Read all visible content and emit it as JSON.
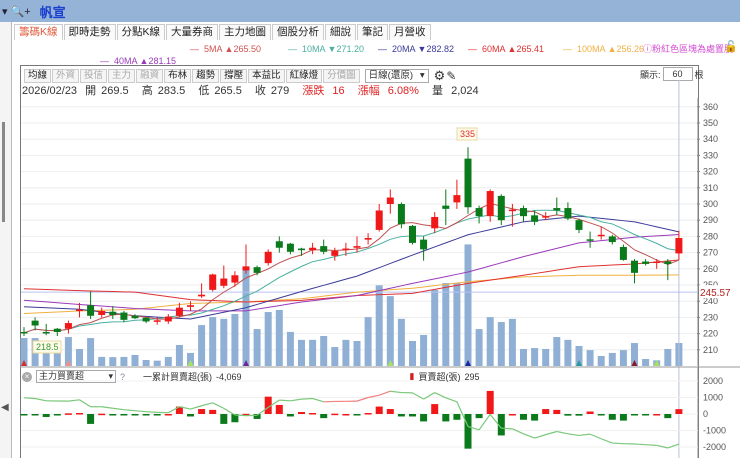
{
  "window": {
    "title": "帆宣",
    "dropdown_icon": "▾",
    "zoom_icon": "🔍+"
  },
  "tabs": [
    {
      "label": "籌碼K線",
      "active": true
    },
    {
      "label": "即時走勢"
    },
    {
      "label": "分點K線"
    },
    {
      "label": "大量券商"
    },
    {
      "label": "主力地圖"
    },
    {
      "label": "個股分析"
    },
    {
      "label": "細說"
    },
    {
      "label": "筆記"
    },
    {
      "label": "月營收"
    }
  ],
  "ma_legend": [
    {
      "name": "5MA",
      "dir": "▲",
      "value": "265.50",
      "color": "#d05050"
    },
    {
      "name": "10MA",
      "dir": "▼",
      "value": "271.20",
      "color": "#48b0a0"
    },
    {
      "name": "20MA",
      "dir": "▼",
      "value": "282.82",
      "color": "#3a3a9a"
    },
    {
      "name": "60MA",
      "dir": "▲",
      "value": "265.41",
      "color": "#e03030"
    },
    {
      "name": "100MA",
      "dir": "▲",
      "value": "256.26",
      "color": "#f0b040"
    },
    {
      "name": "40MA",
      "dir": "▲",
      "value": "281.15",
      "color": "#9a3aba"
    }
  ],
  "note": "ⓘ粉紅色區塊為處置股",
  "toolbar": {
    "buttons": [
      {
        "label": "均線"
      },
      {
        "label": "外資",
        "disabled": true
      },
      {
        "label": "投信",
        "disabled": true
      },
      {
        "label": "主力",
        "disabled": true
      },
      {
        "label": "融資",
        "disabled": true
      },
      {
        "label": "布林"
      },
      {
        "label": "趨勢"
      },
      {
        "label": "撐壓"
      },
      {
        "label": "本益比"
      },
      {
        "label": "紅綠燈"
      },
      {
        "label": "分價圖",
        "disabled": true
      }
    ],
    "period": "日線(還原)",
    "show_label": "顯示:",
    "show_count": "60",
    "show_unit": "根"
  },
  "info": {
    "date": "2026/02/23",
    "open_label": "開",
    "open": "269.5",
    "high_label": "高",
    "high": "283.5",
    "low_label": "低",
    "low": "265.5",
    "close_label": "收",
    "close": "279",
    "change_label": "漲跌",
    "change": "16",
    "pct_label": "漲幅",
    "pct": "6.08%",
    "vol_label": "量",
    "vol": "2,024"
  },
  "chart_data": {
    "type": "candlestick",
    "y_ticks": [
      360,
      350,
      340,
      330,
      320,
      310,
      300,
      290,
      280,
      270,
      260,
      250,
      240,
      230,
      220,
      210
    ],
    "ylim": [
      203,
      362
    ],
    "ref_line": {
      "value": 245.57,
      "label": "245.57"
    },
    "high_label": "335",
    "low_label": "218.5",
    "ohlc": [
      [
        221,
        224,
        218.5,
        220.5
      ],
      [
        228,
        230,
        222,
        225
      ],
      [
        221,
        226,
        219,
        220.5
      ],
      [
        223,
        223.5,
        218.5,
        221
      ],
      [
        223,
        228,
        220,
        226.5
      ],
      [
        234.5,
        239,
        230,
        234.8
      ],
      [
        237.5,
        246,
        229,
        231
      ],
      [
        231.5,
        236,
        230,
        234
      ],
      [
        233.5,
        237,
        229,
        231.5
      ],
      [
        233,
        234,
        227,
        228.5
      ],
      [
        231,
        232,
        229,
        229.5
      ],
      [
        229.8,
        230,
        226.5,
        227.5
      ],
      [
        228,
        230,
        225.5,
        228.2
      ],
      [
        227.5,
        232,
        226,
        230.5
      ],
      [
        231,
        239,
        230,
        236
      ],
      [
        236.5,
        240,
        234,
        237.5
      ],
      [
        243,
        251,
        242,
        244
      ],
      [
        247,
        257,
        246,
        256.5
      ],
      [
        249.5,
        262,
        248,
        254
      ],
      [
        251.5,
        258.5,
        249,
        256
      ],
      [
        259,
        275,
        257,
        261.5
      ],
      [
        261,
        262,
        256,
        257.5
      ],
      [
        263.5,
        272,
        262,
        270.5
      ],
      [
        277,
        280,
        270,
        273
      ],
      [
        275.5,
        276,
        269,
        270.5
      ],
      [
        272.5,
        273,
        268,
        271.5
      ],
      [
        271.5,
        276,
        269,
        273
      ],
      [
        274,
        278,
        269,
        270.5
      ],
      [
        268,
        273,
        265,
        271
      ],
      [
        272,
        276,
        268,
        272.5
      ],
      [
        273,
        280,
        270,
        274
      ],
      [
        278,
        282,
        275,
        279
      ],
      [
        284,
        300,
        283,
        296
      ],
      [
        300,
        309,
        294,
        304
      ],
      [
        300,
        301,
        285,
        287.5
      ],
      [
        286.5,
        287,
        275,
        276
      ],
      [
        278,
        280,
        265,
        272
      ],
      [
        285,
        295,
        282,
        292
      ],
      [
        299,
        309,
        287,
        297
      ],
      [
        301,
        315,
        297,
        305.5
      ],
      [
        328,
        335,
        294,
        298
      ],
      [
        297.5,
        299,
        288,
        292.5
      ],
      [
        292.5,
        309,
        289,
        308
      ],
      [
        305,
        306,
        287,
        290
      ],
      [
        296,
        300,
        286,
        296.5
      ],
      [
        297.5,
        299,
        289,
        292.5
      ],
      [
        293,
        296,
        287,
        289
      ],
      [
        292,
        295,
        290,
        292.5
      ],
      [
        297.5,
        304,
        293,
        296
      ],
      [
        297.5,
        301,
        290,
        291
      ],
      [
        290,
        291,
        282,
        284
      ],
      [
        278.2,
        283,
        273,
        278
      ],
      [
        280.8,
        286,
        278,
        281
      ],
      [
        280,
        281,
        275,
        276.5
      ],
      [
        273.5,
        275,
        265,
        265.5
      ],
      [
        265,
        266,
        251,
        257.5
      ],
      [
        264.5,
        266,
        262,
        263
      ],
      [
        264,
        266,
        260,
        264.5
      ],
      [
        264.5,
        266,
        253,
        263
      ],
      [
        269.5,
        283.5,
        265.5,
        279
      ]
    ],
    "volume": [
      2460,
      2460,
      2020,
      2000,
      2550,
      1500,
      2460,
      800,
      780,
      800,
      970,
      530,
      470,
      800,
      1850,
      1150,
      3600,
      4300,
      4150,
      4580,
      8700,
      3250,
      4750,
      4930,
      3000,
      2300,
      2300,
      2640,
      1670,
      2300,
      2200,
      4300,
      7100,
      6150,
      4150,
      2200,
      2730,
      6700,
      7300,
      7300,
      10700,
      3250,
      4300,
      3870,
      4150,
      1500,
      1580,
      1500,
      2550,
      2300,
      1760,
      1400,
      880,
      1150,
      1400,
      2020,
      620,
      500,
      1500,
      2024
    ],
    "markers": [
      {
        "i": 0,
        "color": "#d03030"
      },
      {
        "i": 4,
        "color": "#f09090"
      },
      {
        "i": 15,
        "color": "#a8e060"
      },
      {
        "i": 20,
        "color": "#6a2a9a"
      },
      {
        "i": 33,
        "color": "#a8e060"
      },
      {
        "i": 40,
        "color": "#1a2a9a"
      },
      {
        "i": 50,
        "color": "#2a9aa0"
      },
      {
        "i": 55,
        "color": "#8a1a2a"
      },
      {
        "i": 57,
        "color": "#a8e060"
      }
    ],
    "ma_samples_every5": {
      "20MA": [
        236.6,
        235,
        231,
        229,
        236,
        246,
        255.5,
        268.5,
        281,
        289,
        292.5,
        289,
        282.82
      ],
      "40MA": [
        240.6,
        238,
        235.5,
        234,
        234,
        239.5,
        243.5,
        251,
        258,
        267.5,
        276,
        279.5,
        281.15
      ],
      "60MA": [
        247.7,
        246.5,
        245.6,
        241,
        239.5,
        240.5,
        243.5,
        244.8,
        251,
        256,
        261.3,
        263,
        265.41
      ],
      "100MA": [
        232.4,
        234,
        235,
        238.6,
        239.6,
        241.5,
        245.6,
        248,
        252,
        255,
        256,
        256,
        256.26
      ]
    },
    "lower": {
      "indicator": "主力買賣超",
      "help": "?",
      "cum_label": "一累計買賣超(張)",
      "cum_value": "-4,069",
      "bar_label": "買賣超(張)",
      "bar_value": "295",
      "y_ticks": [
        2000,
        1000,
        0,
        -1000,
        -2000
      ],
      "bars": [
        -60,
        -60,
        -180,
        -60,
        40,
        60,
        -600,
        20,
        -80,
        -80,
        -80,
        -80,
        -80,
        0,
        450,
        -150,
        300,
        250,
        -600,
        -500,
        10,
        -300,
        1050,
        550,
        -150,
        120,
        60,
        -250,
        20,
        0,
        -20,
        60,
        450,
        300,
        -150,
        -150,
        -450,
        600,
        -450,
        -350,
        -2100,
        -250,
        1400,
        -1300,
        0,
        -350,
        -400,
        300,
        250,
        -100,
        -100,
        150,
        -40,
        -350,
        -400,
        -60,
        -60,
        0,
        -250,
        295
      ],
      "line": [
        980,
        940,
        800,
        790,
        780,
        860,
        440,
        440,
        350,
        260,
        200,
        140,
        100,
        80,
        440,
        300,
        500,
        680,
        340,
        -60,
        -100,
        -80,
        400,
        840,
        800,
        900,
        940,
        740,
        760,
        770,
        780,
        1000,
        1140,
        1380,
        1300,
        1280,
        900,
        1300,
        980,
        740,
        -760,
        -960,
        -20,
        -860,
        -900,
        -1200,
        -1460,
        -1250,
        -1060,
        -1200,
        -1300,
        -1220,
        -1500,
        -1760,
        -1800,
        -1820,
        -1860,
        -1900,
        -2060,
        -1820
      ]
    }
  }
}
